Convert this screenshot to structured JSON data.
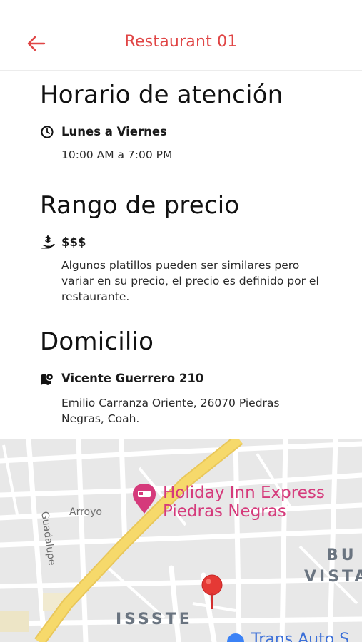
{
  "header": {
    "title": "Restaurant 01"
  },
  "hours": {
    "title": "Horario de atención",
    "days": "Lunes a Viernes",
    "time": "10:00 AM a 7:00 PM"
  },
  "price": {
    "title": "Rango de precio",
    "range": "$$$",
    "note": "Algunos platillos pueden ser similares pero variar en su precio, el precio es definido por el restaurante."
  },
  "address": {
    "title": "Domicilio",
    "street": "Vicente Guerrero 210",
    "detail": "Emilio Carranza Oriente, 26070 Piedras Negras, Coah."
  },
  "map": {
    "poi_line1": "Holiday Inn Express",
    "poi_line2": "Piedras Negras",
    "street_arroyo": "Arroyo",
    "street_guadalupe": "Guadalupe",
    "district_bu": "BU",
    "district_vista": "VISTA",
    "district_issste": "ISSSTE",
    "poi_partial": "Trans Auto S",
    "colors": {
      "road_major": "#f6d96b",
      "road_minor": "#ffffff",
      "land": "#e8e8e8",
      "poi": "#d53a7b",
      "pin": "#e53935"
    }
  },
  "icons": {
    "back": "arrow-left-icon",
    "clock": "clock-icon",
    "price": "hand-money-icon",
    "map": "map-marker-icon"
  }
}
